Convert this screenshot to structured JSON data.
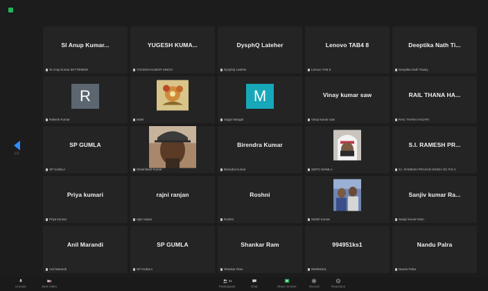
{
  "colors": {
    "accent": "#2d8cff",
    "share_green": "#22b35c",
    "avatar_gray": "#5c6670",
    "avatar_teal": "#16a8b8"
  },
  "navigation": {
    "prev_page_label": "1/2"
  },
  "tiles": [
    {
      "name": "SI Anup Kumar...",
      "label": "SI Anup kumar 6KTT6056W"
    },
    {
      "name": "YUGESH KUMA...",
      "label": "YUGESH KUMAR SINGH"
    },
    {
      "name": "DysphQ Lateher",
      "label": "DysphQ Lateher"
    },
    {
      "name": "Lenovo TAB4 8",
      "label": "Lenovo TAB 8"
    },
    {
      "name": "Deeptika Nath Ti...",
      "label": "Deeptika Nath Tiwary"
    },
    {
      "avatar": "R",
      "label": "Rakesh Kumar"
    },
    {
      "photo": "decor",
      "label": "iwi80"
    },
    {
      "avatar": "M",
      "label": "Sagar Mangal"
    },
    {
      "name": "Vinay kumar saw",
      "label": "Vinay kumar saw"
    },
    {
      "name": "RAIL THANA HA...",
      "label": "RAIL THANA HAZARI"
    },
    {
      "name": "SP GUMLA",
      "label": "SP GUMLA"
    },
    {
      "photo": "person-cap",
      "label": "Shashikant Kumar"
    },
    {
      "name": "Birendra Kumar",
      "label": "Birendra Kumar"
    },
    {
      "photo": "person-scarf",
      "label": "SDPO SHIMLA"
    },
    {
      "name": "S.I. RAMESH PR...",
      "label": "S.I. RAMESH PRASAD SINGH OC P.S.C"
    },
    {
      "name": "Priya kumari",
      "label": "Priya kumari"
    },
    {
      "name": "rajni ranjan",
      "label": "rajni ranjan"
    },
    {
      "name": "Roshni",
      "label": "Roshni"
    },
    {
      "photo": "group",
      "label": "Satish Kumar"
    },
    {
      "name": "Sanjiv kumar Ra...",
      "label": "Sanjiv kumar Ram"
    },
    {
      "name": "Anil Marandi",
      "label": "Anil Marandi"
    },
    {
      "name": "SP GUMLA",
      "label": "SP GUMLA"
    },
    {
      "name": "Shankar Ram",
      "label": "Shankar Ram"
    },
    {
      "name": "994951ks1",
      "label": "994951ks1"
    },
    {
      "name": "Nandu Palra",
      "label": "Nandu Palra"
    }
  ],
  "toolbar": {
    "unmute": "Unmute",
    "start_video": "Start Video",
    "participants": "Participants",
    "participants_count": "31",
    "chat": "Chat",
    "share_screen": "Share Screen",
    "record": "Record",
    "reactions": "Reactions"
  }
}
